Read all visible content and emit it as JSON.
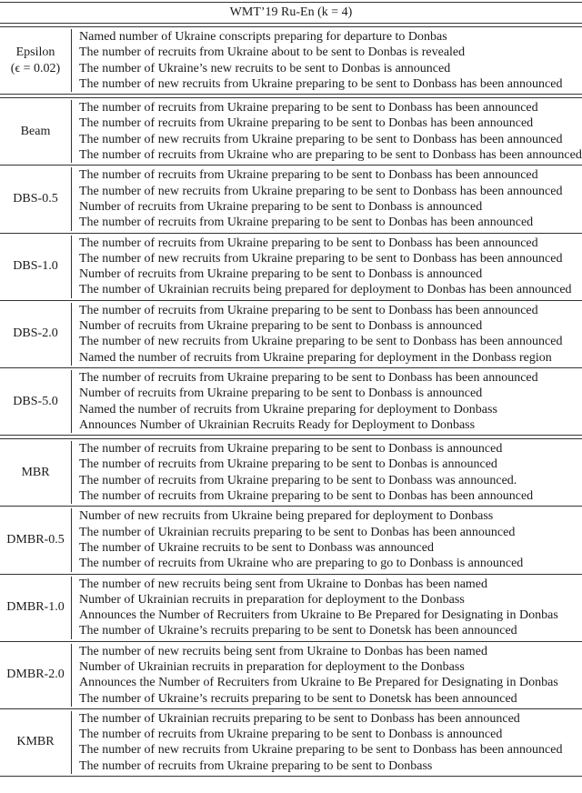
{
  "title": "WMT’19 Ru-En (k = 4)",
  "groups": [
    {
      "rows": [
        {
          "method": "Epsilon",
          "sub": "(ϵ = 0.02)",
          "outputs": [
            "Named number of Ukraine conscripts preparing for departure to Donbas",
            "The number of recruits from Ukraine about to be sent to Donbas is revealed",
            "The number of Ukraine’s new recruits to be sent to Donbas is announced",
            "The number of new recruits from Ukraine preparing to be sent to Donbass has been announced"
          ]
        }
      ]
    },
    {
      "rows": [
        {
          "method": "Beam",
          "outputs": [
            "The number of recruits from Ukraine preparing to be sent to Donbass has been announced",
            "The number of recruits from Ukraine preparing to be sent to Donbas has been announced",
            "The number of new recruits from Ukraine preparing to be sent to Donbass has been announced",
            "The number of recruits from Ukraine who are preparing to be sent to Donbass has been announced"
          ]
        },
        {
          "method": "DBS-0.5",
          "outputs": [
            "The number of recruits from Ukraine preparing to be sent to Donbass has been announced",
            "The number of new recruits from Ukraine preparing to be sent to Donbass has been announced",
            "Number of recruits from Ukraine preparing to be sent to Donbass is announced",
            "The number of recruits from Ukraine preparing to be sent to Donbas has been announced"
          ]
        },
        {
          "method": "DBS-1.0",
          "outputs": [
            "The number of recruits from Ukraine preparing to be sent to Donbass has been announced",
            "The number of new recruits from Ukraine preparing to be sent to Donbass has been announced",
            "Number of recruits from Ukraine preparing to be sent to Donbass is announced",
            "The number of Ukrainian recruits being prepared for deployment to Donbas has been announced"
          ]
        },
        {
          "method": "DBS-2.0",
          "outputs": [
            "The number of recruits from Ukraine preparing to be sent to Donbass has been announced",
            "Number of recruits from Ukraine preparing to be sent to Donbass is announced",
            "The number of new recruits from Ukraine preparing to be sent to Donbass has been announced",
            "Named the number of recruits from Ukraine preparing for deployment in the Donbass region"
          ]
        },
        {
          "method": "DBS-5.0",
          "outputs": [
            "The number of recruits from Ukraine preparing to be sent to Donbass has been announced",
            "Number of recruits from Ukraine preparing to be sent to Donbass is announced",
            "Named the number of recruits from Ukraine preparing for deployment to Donbass",
            "Announces Number of Ukrainian Recruits Ready for Deployment to Donbass"
          ]
        }
      ]
    },
    {
      "rows": [
        {
          "method": "MBR",
          "outputs": [
            "The number of recruits from Ukraine preparing to be sent to Donbass is announced",
            "The number of recruits from Ukraine preparing to be sent to Donbas is announced",
            "The number of recruits from Ukraine preparing to be sent to Donbass was announced.",
            "The number of recruits from Ukraine preparing to be sent to Donbas has been announced"
          ]
        },
        {
          "method": "DMBR-0.5",
          "outputs": [
            "Number of new recruits from Ukraine being prepared for deployment to Donbass",
            "The number of Ukrainian recruits preparing to be sent to Donbas has been announced",
            "The number of Ukraine recruits to be sent to Donbass was announced",
            "The number of recruits from Ukraine who are preparing to go to Donbass is announced"
          ]
        },
        {
          "method": "DMBR-1.0",
          "outputs": [
            "The number of new recruits being sent from Ukraine to Donbas has been named",
            "Number of Ukrainian recruits in preparation for deployment to the Donbass",
            "Announces the Number of Recruiters from Ukraine to Be Prepared for Designating in Donbas",
            "The number of Ukraine’s recruits preparing to be sent to Donetsk has been announced"
          ]
        },
        {
          "method": "DMBR-2.0",
          "outputs": [
            "The number of new recruits being sent from Ukraine to Donbas has been named",
            "Number of Ukrainian recruits in preparation for deployment to the Donbass",
            "Announces the Number of Recruiters from Ukraine to Be Prepared for Designating in Donbas",
            "The number of Ukraine’s recruits preparing to be sent to Donetsk has been announced"
          ]
        },
        {
          "method": "KMBR",
          "outputs": [
            "The number of Ukrainian recruits preparing to be sent to Donbass has been announced",
            "The number of recruits from Ukraine preparing to be sent to Donbass is announced",
            "The number of new recruits from Ukraine preparing to be sent to Donbass has been announced",
            "The number of recruits from Ukraine preparing to be sent to Donbass"
          ]
        }
      ]
    }
  ]
}
